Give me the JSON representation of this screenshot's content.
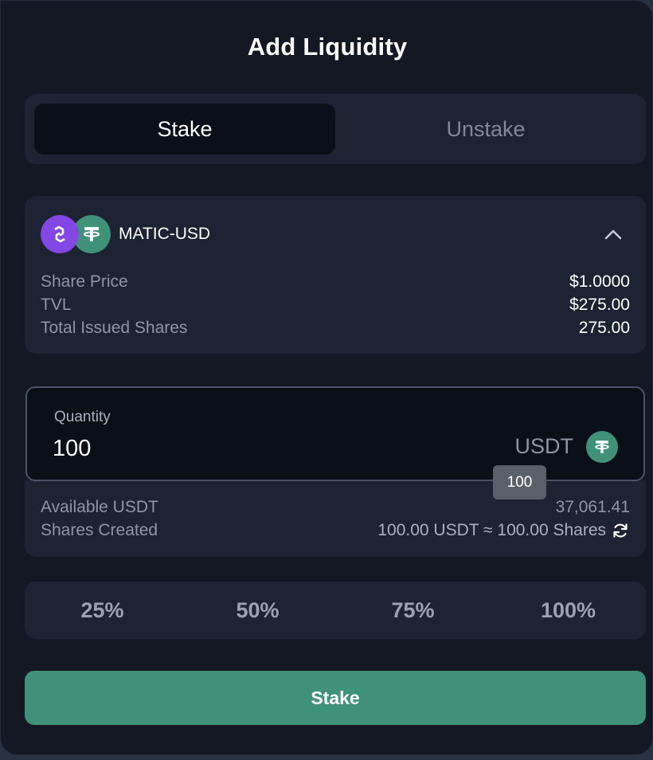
{
  "modal": {
    "title": "Add Liquidity"
  },
  "tabs": [
    {
      "label": "Stake",
      "active": true
    },
    {
      "label": "Unstake",
      "active": false
    }
  ],
  "pool": {
    "pair": "MATIC-USD",
    "icons": [
      "matic-icon",
      "usdt-icon"
    ],
    "collapse_icon": "chevron-up-icon",
    "stats": [
      {
        "label": "Share Price",
        "value": "$1.0000"
      },
      {
        "label": "TVL",
        "value": "$275.00"
      },
      {
        "label": "Total Issued Shares",
        "value": "275.00"
      }
    ]
  },
  "quantity": {
    "label": "Quantity",
    "value": "100",
    "unit": "USDT",
    "unit_icon": "usdt-icon",
    "tooltip": "100"
  },
  "info": {
    "available_label": "Available USDT",
    "available_value": "37,061.41",
    "shares_label": "Shares Created",
    "shares_value": "100.00 USDT ≈ 100.00 Shares",
    "refresh_icon": "refresh-icon"
  },
  "percent_options": [
    "25%",
    "50%",
    "75%",
    "100%"
  ],
  "submit": {
    "label": "Stake"
  },
  "colors": {
    "accent": "#3f9277",
    "matic": "#8247e5",
    "background": "#131824",
    "panel": "#1d2333"
  }
}
